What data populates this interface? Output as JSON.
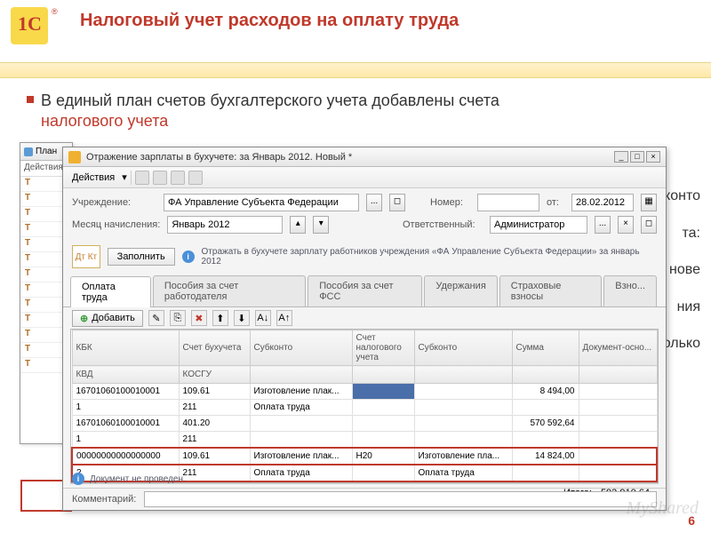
{
  "slide": {
    "title": "Налоговый учет расходов на оплату труда",
    "bullet1_a": "В единый план счетов бухгалтерского учета добавлены счета",
    "bullet1_b": "налогового учета",
    "page_num": "6",
    "watermark": "MyShared"
  },
  "bg_words": [
    "бконто",
    "та:",
    "нове",
    "ния",
    "олько"
  ],
  "back_win": {
    "title": "План",
    "actions": "Действия",
    "row_marker": "Т"
  },
  "window": {
    "title": "Отражение зарплаты в бухучете: за Январь 2012. Новый *",
    "actions": "Действия",
    "labels": {
      "org": "Учреждение:",
      "org_val": "ФА Управление Субъекта Федерации",
      "month": "Месяц начисления:",
      "month_val": "Январь 2012",
      "num": "Номер:",
      "date": "от:",
      "date_val": "28.02.2012",
      "resp": "Ответственный:",
      "resp_val": "Администратор"
    },
    "fill_btn": "Заполнить",
    "info": "Отражать в бухучете зарплату работников учреждения «ФА Управление Субъекта Федерации» за январь 2012",
    "tabs": [
      "Оплата труда",
      "Пособия за счет работодателя",
      "Пособия за счет ФСС",
      "Удержания",
      "Страховые взносы",
      "Взно..."
    ],
    "add_btn": "Добавить",
    "columns_top": [
      "КБК",
      "Счет бухучета",
      "Субконто",
      "Счет налогового учета",
      "Субконто",
      "Сумма",
      "Документ-осно..."
    ],
    "columns_bot": [
      "КВД",
      "КОСГУ",
      "",
      "",
      "",
      "",
      ""
    ],
    "rows": [
      {
        "r1": [
          "16701060100010001",
          "109.61",
          "Изготовление плак...",
          "",
          "",
          "8 494,00",
          ""
        ],
        "r2": [
          "1",
          "211",
          "Оплата труда",
          "",
          "",
          "",
          ""
        ]
      },
      {
        "r1": [
          "16701060100010001",
          "401.20",
          "",
          "",
          "",
          "570 592,64",
          ""
        ],
        "r2": [
          "1",
          "211",
          "",
          "",
          "",
          "",
          ""
        ]
      },
      {
        "r1": [
          "00000000000000000",
          "109.61",
          "Изготовление плак...",
          "Н20",
          "Изготовление пла...",
          "14 824,00",
          ""
        ],
        "r2": [
          "2",
          "211",
          "Оплата труда",
          "",
          "Оплата труда",
          "",
          ""
        ],
        "highlight": true
      }
    ],
    "total_label": "Итого:",
    "total_val": "593 910,64",
    "status": "Документ не проведен.",
    "comment_label": "Комментарий:"
  }
}
